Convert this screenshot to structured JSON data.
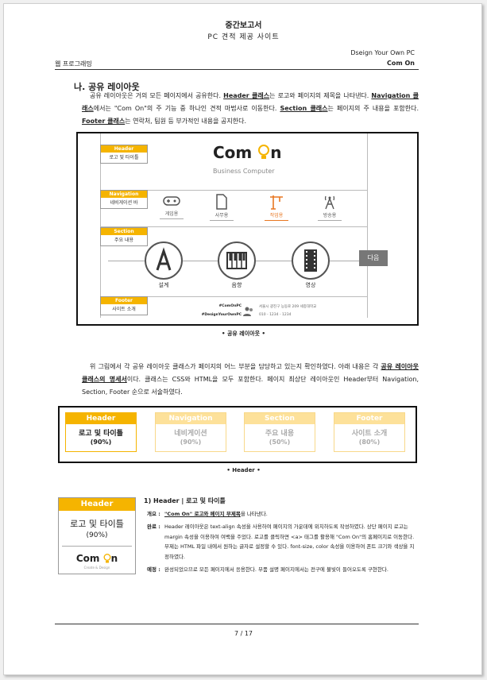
{
  "header": {
    "title": "중간보고서",
    "subtitle": "PC 견적 제공 사이트",
    "right_top": "Dseign Your Own PC",
    "right_bottom": "Com On",
    "left": "웹 프로그래밍"
  },
  "section": {
    "title": "나. 공유 레이아웃",
    "para1": [
      {
        "t": "공유 레이아웃은 거의 모든 페이지에서 공유한다. "
      },
      {
        "t": "Header 클래스",
        "u": true
      },
      {
        "t": "는 로고와 페이지의 제목을 나타낸다. "
      },
      {
        "t": "Navigation 클래스",
        "u": true
      },
      {
        "t": "에서는 \"Com On\"의 주 기능 중 하나인 견적 마법사로 이동한다. "
      },
      {
        "t": "Section 클래스",
        "u": true
      },
      {
        "t": "는 페이지의 주 내용을 포함한다. "
      },
      {
        "t": "Footer 클래스",
        "u": true
      },
      {
        "t": "는 연락처, 팀원 등 부가적인 내용을 공지한다."
      }
    ],
    "para2": [
      {
        "t": "위 그림에서 각 공유 레이아웃 클래스가 페이지의 어느 부분을 담당하고 있는지 확인하였다. 아래 내용은 각 "
      },
      {
        "t": "공유 레이아웃 클래스의 명세서",
        "u": true
      },
      {
        "t": "이다. 클래스는 CSS와 HTML을 모두 포함한다. 페이지 최상단 레이아웃인 Header부터 Navigation, Section, Footer 순으로 서술하였다."
      }
    ]
  },
  "diagram": {
    "labels": [
      {
        "title": "Header",
        "body": "로고 및 타이틀"
      },
      {
        "title": "Navigation",
        "body": "네비게이션 바"
      },
      {
        "title": "Section",
        "body": "주요 내용"
      },
      {
        "title": "Footer",
        "body": "사이트 소개"
      }
    ],
    "logo": "Com On",
    "logo_sub": "Business Computer",
    "nav_items": [
      "게임용",
      "사무용",
      "작업용",
      "방송용"
    ],
    "section_items": [
      "설계",
      "음향",
      "영상"
    ],
    "next_label": "다음",
    "footer_left": [
      "#ComOnPC",
      "#DesignYourOwnPC"
    ],
    "footer_right": [
      "서울시 광진구 능동로 209 세종대학교",
      "010 - 1234 - 1234"
    ],
    "caption": "• 공유 레이아웃 •"
  },
  "cards": {
    "items": [
      {
        "title": "Header",
        "line1": "로고 및 타이틀",
        "line2": "(90%)",
        "active": true
      },
      {
        "title": "Navigation",
        "line1": "네비게이션",
        "line2": "(90%)",
        "active": false
      },
      {
        "title": "Section",
        "line1": "주요 내용",
        "line2": "(50%)",
        "active": false
      },
      {
        "title": "Footer",
        "line1": "사이트 소개",
        "line2": "(80%)",
        "active": false
      }
    ],
    "caption": "• Header •"
  },
  "detail": {
    "card_title": "Header",
    "card_line1": "로고 및 타이틀",
    "card_line2": "(90%)",
    "card_logo": "Com On",
    "card_logo_sub": "Create & Design",
    "heading": "1) Header | 로고 및 타이틀",
    "rows": [
      {
        "key": "개요 :",
        "parts": [
          {
            "t": "\"Com On\" 로고와 페이지 부제목",
            "u": true
          },
          {
            "t": "을 나타낸다."
          }
        ]
      },
      {
        "key": "완료 :",
        "parts": [
          {
            "t": "Header 레이아웃은 text-align 속성을 사용하여 페이지의 가운데에 위치하도록 작성하였다. 상단 페이지 로고는 margin 속성을 이용하여 여백을 주었다. 로고를 클릭하면 <a> 태그를 활용해 \"Com On\"의 홈페이지로 이동한다. 부제는 HTML 파일 내에서 원하는 글자로 설정할 수 있다. font-size, color 속성을 이용하여 폰트 크기와 색상을 지정하였다."
          }
        ]
      },
      {
        "key": "예정 :",
        "parts": [
          {
            "t": "완성되었으므로 모든 페이지에서 응용한다. 부품 설명 페이지에서는 전구에 불빛이 들어오도록 구현한다."
          }
        ]
      }
    ]
  },
  "footer": {
    "page": "7 / 17"
  },
  "colors": {
    "accent": "#f5b400",
    "accent_light": "#fde19a",
    "orange": "#e87722"
  }
}
